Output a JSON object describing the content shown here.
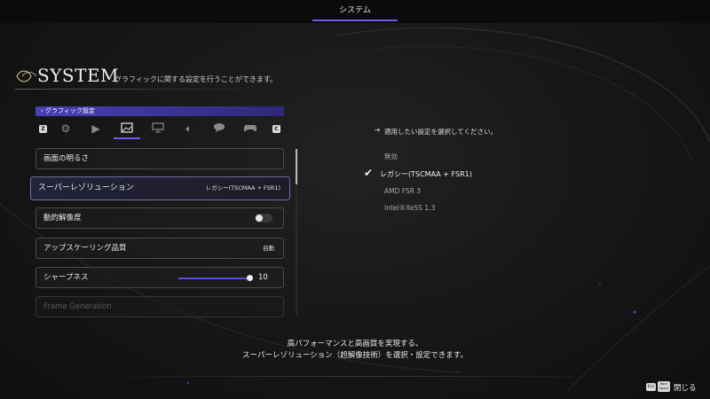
{
  "top_bar": {
    "tab_label": "システム"
  },
  "header": {
    "title": "SYSTEM",
    "subtitle": "グラフィックに関する設定を行うことができます。"
  },
  "section": {
    "label": "› グラフィック設定"
  },
  "category_tabs": {
    "left_key": "Z",
    "right_key": "C",
    "icons": [
      "gear-icon",
      "camera-icon",
      "image-icon",
      "monitor-icon",
      "speaker-icon",
      "chat-icon",
      "gamepad-icon"
    ],
    "active_index": 2
  },
  "settings": [
    {
      "label": "画面の明るさ",
      "type": "button"
    },
    {
      "label": "スーパーレゾリューション",
      "value": "レガシー(TSCMAA + FSR1)",
      "type": "select",
      "selected": true
    },
    {
      "label": "動的解像度",
      "type": "toggle",
      "on": false
    },
    {
      "label": "アップスケーリング品質",
      "value": "自動",
      "type": "select"
    },
    {
      "label": "シャープネス",
      "value": "10",
      "type": "slider",
      "level": 1.0
    },
    {
      "label": "Frame Generation",
      "type": "button",
      "disabled": true
    }
  ],
  "options_panel": {
    "prompt": "適用したい設定を選択してください。",
    "options": [
      "無効",
      "レガシー(TSCMAA + FSR1)",
      "AMD FSR 3",
      "Intel®XeSS 1.3"
    ],
    "selected_index": 1
  },
  "description": {
    "line1": "高パフォーマンスと高画質を実現する、",
    "line2": "スーパーレゾリューション（超解像技術）を選択・設定できます。"
  },
  "footer": {
    "esc_key": "Esc",
    "back_key_line1": "Back",
    "back_key_line2": "Space",
    "close_label": "閉じる"
  },
  "colors": {
    "accent": "#6a5cf0",
    "background": "#141414"
  }
}
